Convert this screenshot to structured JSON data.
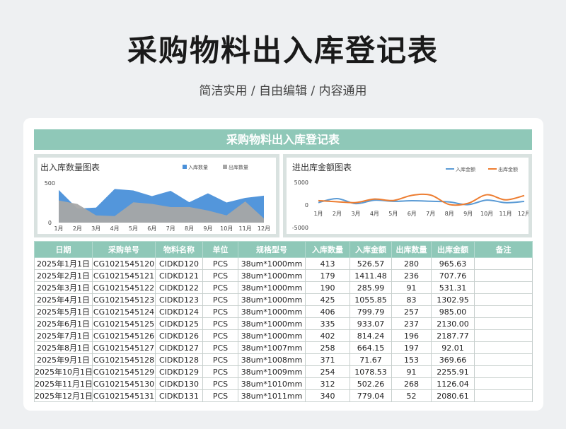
{
  "page": {
    "title": "采购物料出入库登记表",
    "subtitle": "简洁实用 / 自由编辑 / 内容通用"
  },
  "sheet": {
    "title": "采购物料出入库登记表"
  },
  "colors": {
    "accent": "#8fc8b8",
    "in_area": "#4a90d9",
    "out_area": "#a6a6a6",
    "in_line": "#5b9bd5",
    "out_line": "#ed7d31"
  },
  "chart_data": [
    {
      "type": "area",
      "title": "出入库数量图表",
      "categories": [
        "1月",
        "2月",
        "3月",
        "4月",
        "5月",
        "6月",
        "7月",
        "8月",
        "9月",
        "10月",
        "11月",
        "12月"
      ],
      "series": [
        {
          "name": "入库数量",
          "values": [
            413,
            179,
            190,
            425,
            406,
            335,
            402,
            258,
            371,
            254,
            312,
            340
          ]
        },
        {
          "name": "出库数量",
          "values": [
            280,
            236,
            91,
            83,
            257,
            237,
            196,
            197,
            153,
            91,
            268,
            52
          ]
        }
      ],
      "yticks": [
        "500",
        "0"
      ],
      "ylim": [
        0,
        500
      ],
      "legend": "top-right"
    },
    {
      "type": "line",
      "title": "进出库金额图表",
      "categories": [
        "1月",
        "2月",
        "3月",
        "4月",
        "5月",
        "6月",
        "7月",
        "8月",
        "9月",
        "10月",
        "11月",
        "12月"
      ],
      "series": [
        {
          "name": "入库金额",
          "values": [
            526.57,
            1411.48,
            285.99,
            1055.85,
            799.79,
            933.07,
            814.24,
            664.15,
            71.67,
            1078.53,
            502.26,
            779.04
          ]
        },
        {
          "name": "出库金额",
          "values": [
            965.63,
            707.76,
            531.31,
            1302.95,
            985.0,
            2130.0,
            2187.77,
            92.01,
            369.66,
            2255.91,
            1126.04,
            2080.61
          ]
        }
      ],
      "yticks": [
        "5000",
        "0",
        "-5000"
      ],
      "ylim": [
        -5000,
        5000
      ],
      "legend": "top-right"
    }
  ],
  "table": {
    "headers": [
      "日期",
      "采购单号",
      "物料名称",
      "单位",
      "规格型号",
      "入库数量",
      "入库金额",
      "出库数量",
      "出库金额",
      "备注"
    ],
    "rows": [
      [
        "2025年1月1日",
        "CG1021545120",
        "CIDKD120",
        "PCS",
        "38um*1000mm",
        "413",
        "526.57",
        "280",
        "965.63",
        ""
      ],
      [
        "2025年2月1日",
        "CG1021545121",
        "CIDKD121",
        "PCS",
        "38um*1000mm",
        "179",
        "1411.48",
        "236",
        "707.76",
        ""
      ],
      [
        "2025年3月1日",
        "CG1021545122",
        "CIDKD122",
        "PCS",
        "38um*1000mm",
        "190",
        "285.99",
        "91",
        "531.31",
        ""
      ],
      [
        "2025年4月1日",
        "CG1021545123",
        "CIDKD123",
        "PCS",
        "38um*1000mm",
        "425",
        "1055.85",
        "83",
        "1302.95",
        ""
      ],
      [
        "2025年5月1日",
        "CG1021545124",
        "CIDKD124",
        "PCS",
        "38um*1000mm",
        "406",
        "799.79",
        "257",
        "985.00",
        ""
      ],
      [
        "2025年6月1日",
        "CG1021545125",
        "CIDKD125",
        "PCS",
        "38um*1000mm",
        "335",
        "933.07",
        "237",
        "2130.00",
        ""
      ],
      [
        "2025年7月1日",
        "CG1021545126",
        "CIDKD126",
        "PCS",
        "38um*1000mm",
        "402",
        "814.24",
        "196",
        "2187.77",
        ""
      ],
      [
        "2025年8月1日",
        "CG1021545127",
        "CIDKD127",
        "PCS",
        "38um*1007mm",
        "258",
        "664.15",
        "197",
        "92.01",
        ""
      ],
      [
        "2025年9月1日",
        "CG1021545128",
        "CIDKD128",
        "PCS",
        "38um*1008mm",
        "371",
        "71.67",
        "153",
        "369.66",
        ""
      ],
      [
        "2025年10月1日",
        "CG1021545129",
        "CIDKD129",
        "PCS",
        "38um*1009mm",
        "254",
        "1078.53",
        "91",
        "2255.91",
        ""
      ],
      [
        "2025年11月1日",
        "CG1021545130",
        "CIDKD130",
        "PCS",
        "38um*1010mm",
        "312",
        "502.26",
        "268",
        "1126.04",
        ""
      ],
      [
        "2025年12月1日",
        "CG1021545131",
        "CIDKD131",
        "PCS",
        "38um*1011mm",
        "340",
        "779.04",
        "52",
        "2080.61",
        ""
      ]
    ]
  }
}
